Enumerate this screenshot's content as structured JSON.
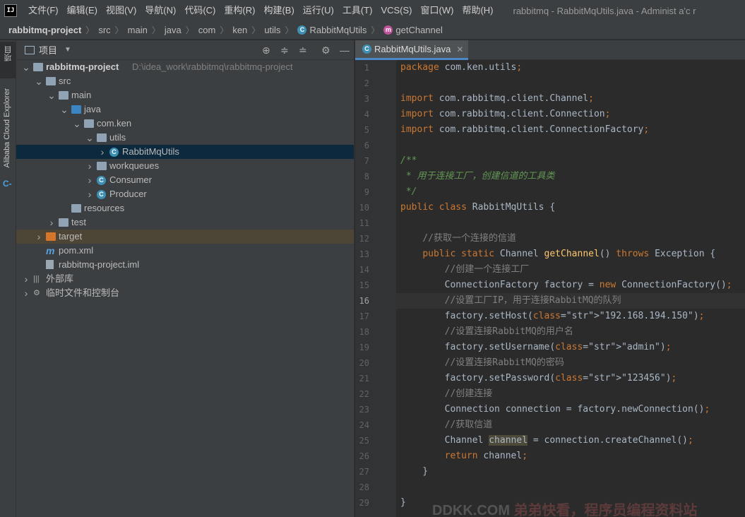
{
  "menubar": {
    "logo": "IJ",
    "items": [
      "文件(F)",
      "编辑(E)",
      "视图(V)",
      "导航(N)",
      "代码(C)",
      "重构(R)",
      "构建(B)",
      "运行(U)",
      "工具(T)",
      "VCS(S)",
      "窗口(W)",
      "帮助(H)"
    ],
    "window_title": "rabbitmq - RabbitMqUtils.java - Administ a'c r"
  },
  "breadcrumb": {
    "items": [
      "rabbitmq-project",
      "src",
      "main",
      "java",
      "com",
      "ken",
      "utils",
      "RabbitMqUtils",
      "getChannel"
    ]
  },
  "left_strip": {
    "project_label": "项目",
    "cloud_label": "Alibaba Cloud Explorer"
  },
  "project_panel": {
    "title": "项目",
    "tree": [
      {
        "label": "rabbitmq-project",
        "path": "D:\\idea_work\\rabbitmq\\rabbitmq-project",
        "level": 0,
        "expanded": true,
        "icon": "module-icon"
      },
      {
        "label": "src",
        "level": 1,
        "expanded": true,
        "icon": "folder-icon"
      },
      {
        "label": "main",
        "level": 2,
        "expanded": true,
        "icon": "folder-icon"
      },
      {
        "label": "java",
        "level": 3,
        "expanded": true,
        "icon": "source-folder-icon"
      },
      {
        "label": "com.ken",
        "level": 4,
        "expanded": true,
        "icon": "package-icon"
      },
      {
        "label": "utils",
        "level": 5,
        "expanded": true,
        "icon": "package-icon"
      },
      {
        "label": "RabbitMqUtils",
        "level": 6,
        "expanded": false,
        "icon": "class-icon",
        "selected": true
      },
      {
        "label": "workqueues",
        "level": 5,
        "expanded": false,
        "icon": "package-icon"
      },
      {
        "label": "Consumer",
        "level": 5,
        "expanded": false,
        "icon": "class-icon"
      },
      {
        "label": "Producer",
        "level": 5,
        "expanded": false,
        "icon": "class-icon"
      },
      {
        "label": "resources",
        "level": 3,
        "icon": "resources-folder-icon"
      },
      {
        "label": "test",
        "level": 2,
        "expanded": false,
        "icon": "folder-icon"
      },
      {
        "label": "target",
        "level": 1,
        "expanded": false,
        "icon": "excluded-folder-icon",
        "highlight": true
      },
      {
        "label": "pom.xml",
        "level": 1,
        "icon": "maven-icon"
      },
      {
        "label": "rabbitmq-project.iml",
        "level": 1,
        "icon": "file-icon"
      },
      {
        "label": "外部库",
        "level": 0,
        "expanded": false,
        "icon": "library-icon"
      },
      {
        "label": "临时文件和控制台",
        "level": 0,
        "expanded": false,
        "icon": "scratch-icon"
      }
    ]
  },
  "editor": {
    "tab_label": "RabbitMqUtils.java",
    "current_line": 16,
    "lines": [
      {
        "n": "1",
        "t": "package com.ken.utils;"
      },
      {
        "n": "2",
        "t": ""
      },
      {
        "n": "3",
        "t": "import com.rabbitmq.client.Channel;"
      },
      {
        "n": "4",
        "t": "import com.rabbitmq.client.Connection;"
      },
      {
        "n": "5",
        "t": "import com.rabbitmq.client.ConnectionFactory;"
      },
      {
        "n": "6",
        "t": ""
      },
      {
        "n": "7",
        "t": "/**"
      },
      {
        "n": "8",
        "t": " * 用于连接工厂，创建信道的工具类"
      },
      {
        "n": "9",
        "t": " */"
      },
      {
        "n": "10",
        "t": "public class RabbitMqUtils {"
      },
      {
        "n": "11",
        "t": ""
      },
      {
        "n": "12",
        "t": "    //获取一个连接的信道"
      },
      {
        "n": "13",
        "t": "    public static Channel getChannel() throws Exception {"
      },
      {
        "n": "14",
        "t": "        //创建一个连接工厂"
      },
      {
        "n": "15",
        "t": "        ConnectionFactory factory = new ConnectionFactory();"
      },
      {
        "n": "16",
        "t": "        //设置工厂IP，用于连接RabbitMQ的队列"
      },
      {
        "n": "17",
        "t": "        factory.setHost(\"192.168.194.150\");"
      },
      {
        "n": "18",
        "t": "        //设置连接RabbitMQ的用户名"
      },
      {
        "n": "19",
        "t": "        factory.setUsername(\"admin\");"
      },
      {
        "n": "20",
        "t": "        //设置连接RabbitMQ的密码"
      },
      {
        "n": "21",
        "t": "        factory.setPassword(\"123456\");"
      },
      {
        "n": "22",
        "t": "        //创建连接"
      },
      {
        "n": "23",
        "t": "        Connection connection = factory.newConnection();"
      },
      {
        "n": "24",
        "t": "        //获取信道"
      },
      {
        "n": "25",
        "t": "        Channel channel = connection.createChannel();"
      },
      {
        "n": "26",
        "t": "        return channel;"
      },
      {
        "n": "27",
        "t": "    }"
      },
      {
        "n": "28",
        "t": ""
      },
      {
        "n": "29",
        "t": "}"
      }
    ]
  },
  "watermark": {
    "latin": "DDKK.COM",
    "cn": " 弟弟快看，程序员编程资料站"
  }
}
